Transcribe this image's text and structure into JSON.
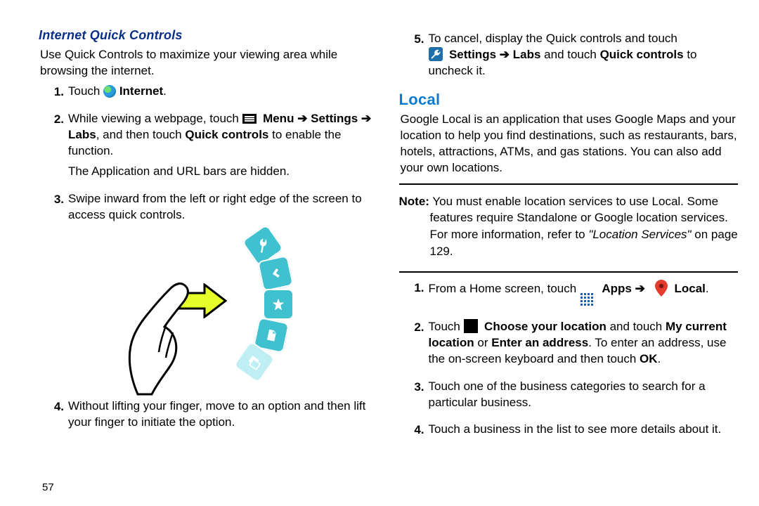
{
  "left": {
    "subheading": "Internet Quick Controls",
    "intro": "Use Quick Controls to maximize your viewing area while browsing the internet.",
    "steps": {
      "s1_pre": "Touch ",
      "s1_post": " Internet",
      "s2_pre": "While viewing a webpage, touch ",
      "s2_menu": "Menu",
      "s2_arrow1": " ➔ ",
      "s2_settings": "Settings",
      "s2_arrow2": " ➔ ",
      "s2_labs": "Labs",
      "s2_mid": ", and then touch ",
      "s2_qc": "Quick controls",
      "s2_end": " to enable the function.",
      "s2_extra": "The Application and URL bars are hidden.",
      "s3": "Swipe inward from the left or right edge of the screen to access quick controls.",
      "s4": "Without lifting your finger, move to an option and then lift your finger to initiate the option."
    }
  },
  "right": {
    "step5_pre": "To cancel, display the Quick controls and touch ",
    "step5_settings": "Settings",
    "step5_arrow": " ➔ ",
    "step5_labs": "Labs",
    "step5_mid": " and touch ",
    "step5_qc": "Quick controls",
    "step5_end": " to uncheck it.",
    "heading": "Local",
    "intro": "Google Local is an application that uses Google Maps and your location to help you find destinations, such as restaurants, bars, hotels, attractions, ATMs, and gas stations. You can also add your own locations.",
    "note_label": "Note:",
    "note_body1": " You must enable location services to use Local. Some features require Standalone or Google location services. For more information, refer to ",
    "note_ref": "\"Location Services\"",
    "note_body2": " on page 129.",
    "steps": {
      "s1_pre": "From a Home screen, touch ",
      "s1_apps": "Apps",
      "s1_arrow": " ➔ ",
      "s1_local": "Local",
      "s1_dot": ".",
      "s2_pre": "Touch ",
      "s2_choose": "Choose your location",
      "s2_mid1": " and touch ",
      "s2_curr": "My current location",
      "s2_or": " or ",
      "s2_enter": "Enter an address",
      "s2_mid2": ". To enter an address, use the on-screen keyboard and then touch ",
      "s2_ok": "OK",
      "s2_dot": ".",
      "s3": "Touch one of the business categories to search for a particular business.",
      "s4": "Touch a business in the list to see more details about it."
    }
  },
  "pagenum": "57"
}
